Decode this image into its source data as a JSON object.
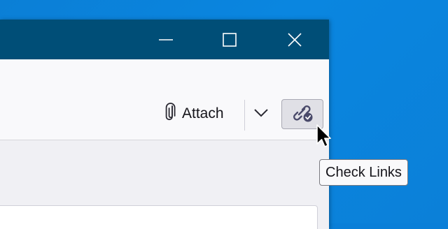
{
  "window": {
    "title_bar_color": "#004e77",
    "controls": {
      "minimize_icon": "minimize-icon",
      "maximize_icon": "maximize-icon",
      "close_icon": "close-icon"
    }
  },
  "toolbar": {
    "attach_label": "Attach",
    "attach_icon": "paperclip-icon",
    "dropdown_icon": "chevron-down-icon",
    "check_links_icon": "link-check-icon"
  },
  "tooltip": {
    "text": "Check Links"
  },
  "colors": {
    "desktop": "#0a7fd8",
    "toolbar_bg": "#f9f9fb",
    "accent_icon": "#4a4a6a"
  }
}
